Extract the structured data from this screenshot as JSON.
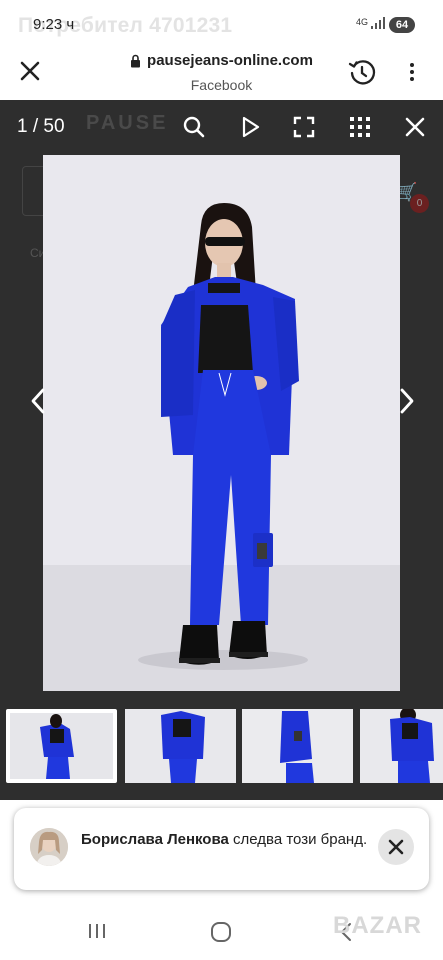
{
  "status": {
    "ghost_title": "Потребител 4701231",
    "time": "9:23 ч",
    "network": "4G",
    "battery": "64"
  },
  "browser": {
    "url": "pausejeans-online.com",
    "source": "Facebook"
  },
  "lightbox": {
    "counter": "1 / 50",
    "background_brand": "PAUSE",
    "background_home_label": "Си",
    "background_cart_badge": "0"
  },
  "product": {
    "colors": {
      "suit": "#1f33d6",
      "top": "#151515",
      "backdrop": "#e9e8ee",
      "floor": "#dcdbe1"
    }
  },
  "thumbnails": [
    {
      "active": true
    },
    {
      "active": false
    },
    {
      "active": false
    },
    {
      "active": false
    }
  ],
  "toast": {
    "name": "Борислава Ленкова",
    "text": " следва този бранд."
  },
  "watermark": "BAZAR",
  "icons": {
    "close": "close-icon",
    "lock": "lock-icon",
    "history": "history-icon",
    "more": "more-vert-icon",
    "zoom": "zoom-icon",
    "play": "play-icon",
    "fullscreen": "fullscreen-icon",
    "grid": "grid-icon",
    "prev": "chevron-left-icon",
    "next": "chevron-right-icon",
    "recents": "recents-icon",
    "home": "home-icon",
    "back": "back-icon"
  }
}
